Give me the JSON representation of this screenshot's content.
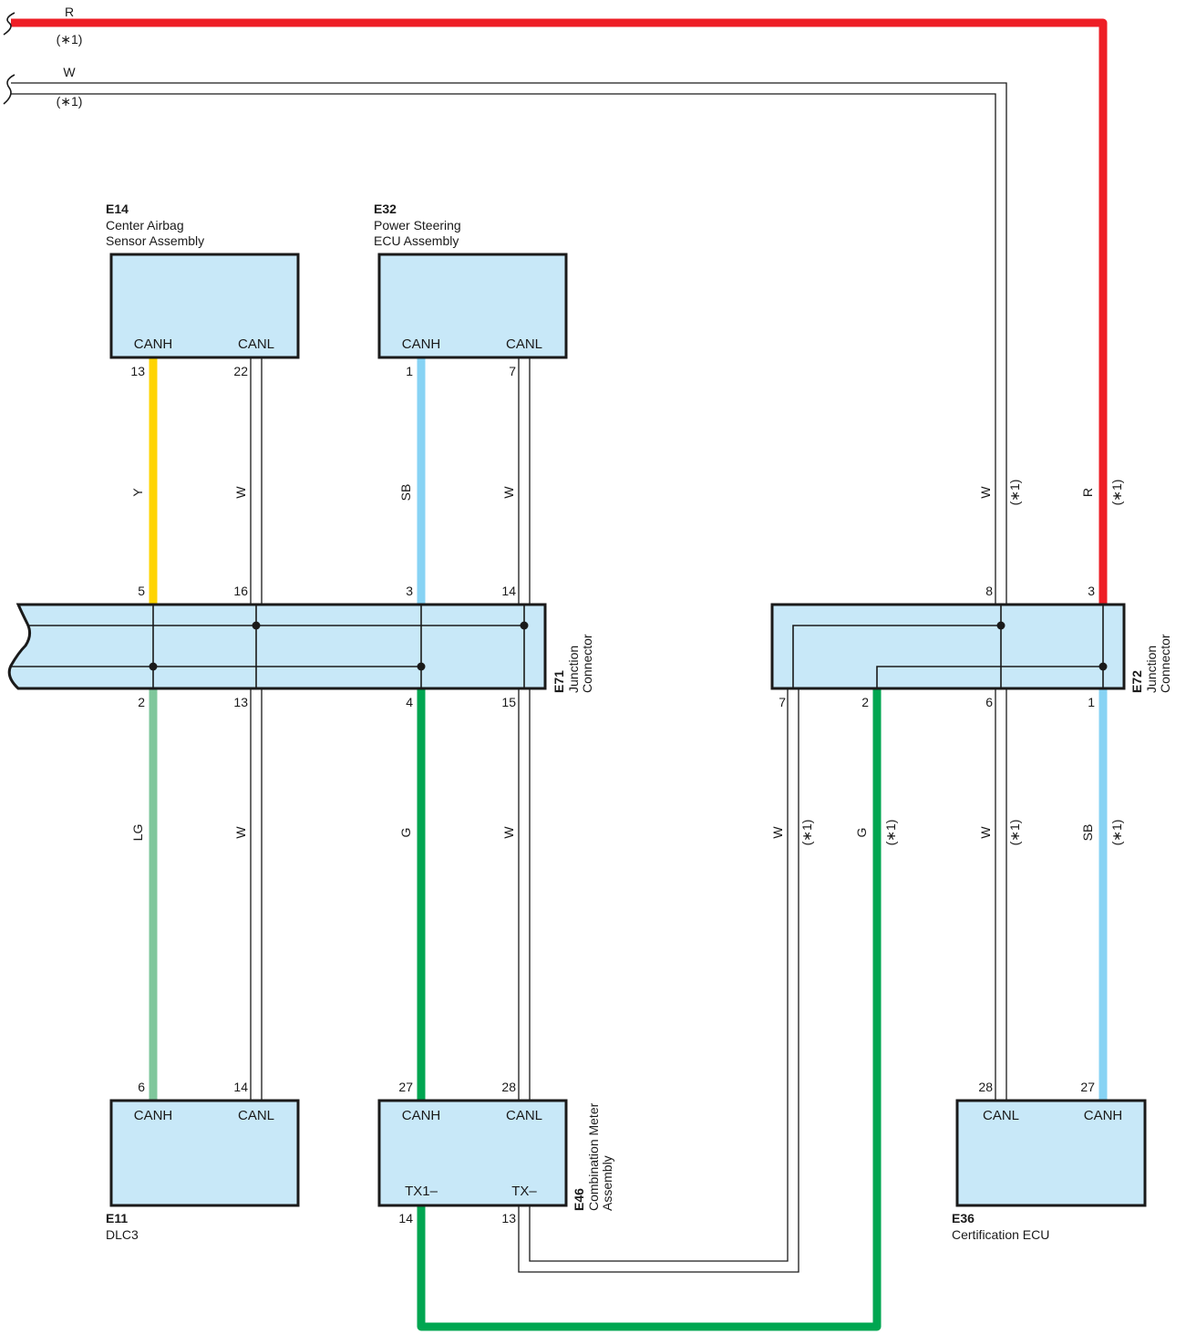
{
  "colors": {
    "R": "#ee1d25",
    "Y": "#ffd400",
    "SB": "#87d3f4",
    "LG": "#7fc79c",
    "G": "#00a651",
    "W": "#ffffff",
    "component_fill": "#c8e8f8",
    "outline": "#1a1a1a"
  },
  "note_marker": "(∗1)",
  "wire_labels": {
    "R": "R",
    "W": "W",
    "Y": "Y",
    "SB": "SB",
    "LG": "LG",
    "G": "G"
  },
  "components": {
    "e14": {
      "code": "E14",
      "name_line1": "Center Airbag",
      "name_line2": "Sensor Assembly",
      "pin_a": "CANH",
      "pin_b": "CANL",
      "pin_a_num": "13",
      "pin_b_num": "22"
    },
    "e32": {
      "code": "E32",
      "name_line1": "Power Steering",
      "name_line2": "ECU Assembly",
      "pin_a": "CANH",
      "pin_b": "CANL",
      "pin_a_num": "1",
      "pin_b_num": "7"
    },
    "e71": {
      "code": "E71",
      "name_line1": "Junction",
      "name_line2": "Connector",
      "top_pins": [
        "5",
        "16",
        "3",
        "14"
      ],
      "bottom_pins": [
        "2",
        "13",
        "4",
        "15"
      ]
    },
    "e72": {
      "code": "E72",
      "name_line1": "Junction",
      "name_line2": "Connector",
      "top_pins": [
        "8",
        "3"
      ],
      "bottom_pins": [
        "7",
        "2",
        "6",
        "1"
      ]
    },
    "e11": {
      "code": "E11",
      "name": "DLC3",
      "pin_a": "CANH",
      "pin_b": "CANL",
      "pin_a_num": "6",
      "pin_b_num": "14"
    },
    "e46": {
      "code": "E46",
      "name_line1": "Combination Meter",
      "name_line2": "Assembly",
      "pin_a": "CANH",
      "pin_b": "CANL",
      "pin_a_num": "27",
      "pin_b_num": "28",
      "pin_c": "TX1–",
      "pin_d": "TX–",
      "pin_c_num": "14",
      "pin_d_num": "13"
    },
    "e36": {
      "code": "E36",
      "name": "Certification ECU",
      "pin_a": "CANL",
      "pin_b": "CANH",
      "pin_a_num": "28",
      "pin_b_num": "27"
    }
  }
}
